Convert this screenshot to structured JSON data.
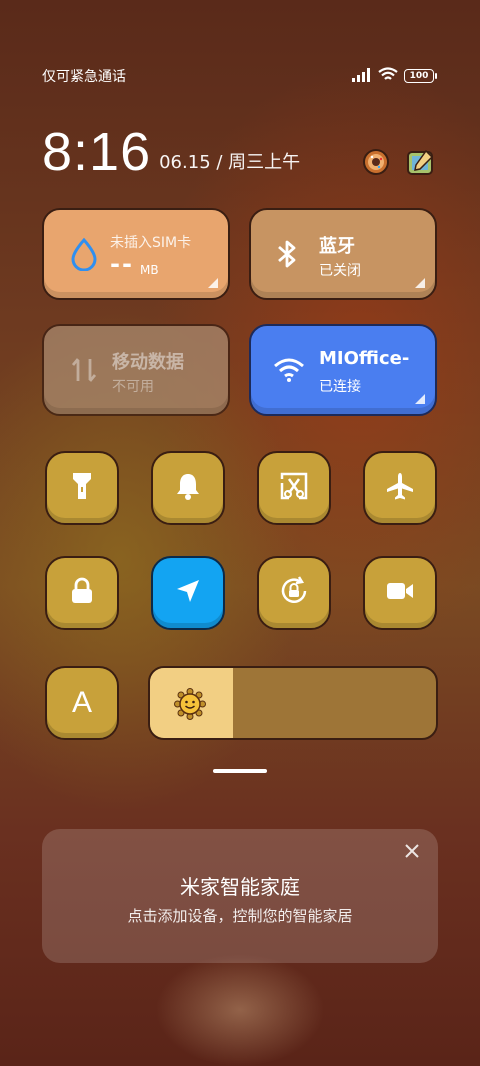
{
  "status_bar": {
    "carrier_text": "仅可紧急通话",
    "battery_level": "100",
    "icons": [
      "signal-icon",
      "wifi-icon",
      "battery-icon"
    ]
  },
  "clock": {
    "time": "8:16",
    "date": "06.15 / 周三上午",
    "apps": [
      "donut-app-icon",
      "paint-app-icon"
    ]
  },
  "tiles": {
    "data_usage": {
      "title": "未插入SIM卡",
      "value": "--",
      "unit": "MB",
      "icon": "water-drop-icon",
      "color": "#e8a56e"
    },
    "bluetooth": {
      "title": "蓝牙",
      "status": "已关闭",
      "icon": "bluetooth-icon",
      "color": "#c79462"
    },
    "mobile_data": {
      "title": "移动数据",
      "status": "不可用",
      "icon": "data-arrows-icon",
      "color": "#a9896e"
    },
    "wifi": {
      "title": "MIOffice-",
      "status": "已连接",
      "icon": "wifi-icon",
      "color": "#4a7ef0"
    }
  },
  "toggles": [
    {
      "name": "flashlight",
      "icon": "flashlight-icon",
      "active": false
    },
    {
      "name": "silent",
      "icon": "bell-icon",
      "active": false
    },
    {
      "name": "screenshot",
      "icon": "scissors-icon",
      "active": false
    },
    {
      "name": "airplane",
      "icon": "airplane-icon",
      "active": false
    },
    {
      "name": "lock",
      "icon": "lock-icon",
      "active": false
    },
    {
      "name": "location",
      "icon": "location-arrow-icon",
      "active": true
    },
    {
      "name": "rotation-lock",
      "icon": "rotation-lock-icon",
      "active": false
    },
    {
      "name": "screen-record",
      "icon": "video-camera-icon",
      "active": false
    }
  ],
  "auto_brightness": {
    "label": "A"
  },
  "brightness": {
    "level": 0.29,
    "icon": "sun-icon"
  },
  "mihome": {
    "title": "米家智能家庭",
    "subtitle": "点击添加设备，控制您的智能家居",
    "close_icon": "close-icon"
  },
  "colors": {
    "tile_gold": "#c8a13a",
    "tile_blue": "#13a4f2",
    "tile_border": "#3a1e12",
    "brightness_fill": "#f2cf83",
    "brightness_track": "#9e7537"
  }
}
